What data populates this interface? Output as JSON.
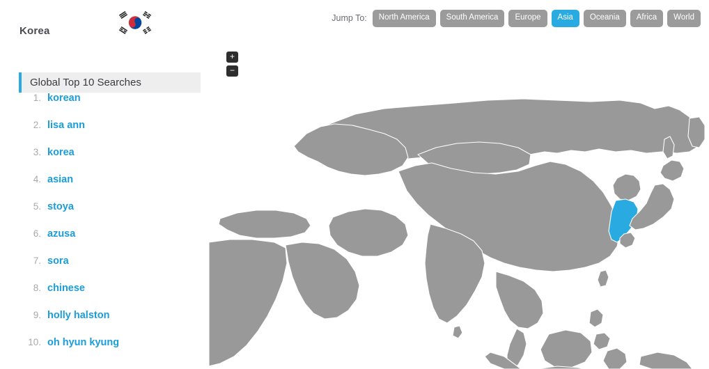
{
  "header": {
    "country_title": "Korea",
    "flag_name": "south-korea-flag",
    "flag_colors": {
      "red": "#cd2e3a",
      "blue": "#0047a0",
      "trigram": "#2b2b2b",
      "field": "#ffffff"
    }
  },
  "jump_nav": {
    "label": "Jump To:",
    "active": "Asia",
    "buttons": [
      {
        "label": "North America",
        "active": false
      },
      {
        "label": "South America",
        "active": false
      },
      {
        "label": "Europe",
        "active": false
      },
      {
        "label": "Asia",
        "active": true
      },
      {
        "label": "Oceania",
        "active": false
      },
      {
        "label": "Africa",
        "active": false
      },
      {
        "label": "World",
        "active": false
      }
    ],
    "colors": {
      "inactive_bg": "#9b9b9b",
      "active_bg": "#29abe2",
      "text": "#ffffff"
    }
  },
  "searches": {
    "header": "Global Top 10 Searches",
    "accent_color": "#29abe2",
    "items": [
      {
        "rank": "1.",
        "term": "korean"
      },
      {
        "rank": "2.",
        "term": "lisa ann"
      },
      {
        "rank": "3.",
        "term": "korea"
      },
      {
        "rank": "4.",
        "term": "asian"
      },
      {
        "rank": "5.",
        "term": "stoya"
      },
      {
        "rank": "6.",
        "term": "azusa"
      },
      {
        "rank": "7.",
        "term": "sora"
      },
      {
        "rank": "8.",
        "term": "chinese"
      },
      {
        "rank": "9.",
        "term": "holly halston"
      },
      {
        "rank": "10.",
        "term": "oh hyun kyung"
      }
    ]
  },
  "map": {
    "region": "Asia",
    "highlighted_country": "South Korea",
    "land_color": "#999999",
    "border_color": "#ffffff",
    "highlight_color": "#29abe2",
    "background_color": "#ffffff",
    "zoom_in_label": "+",
    "zoom_out_label": "−"
  }
}
